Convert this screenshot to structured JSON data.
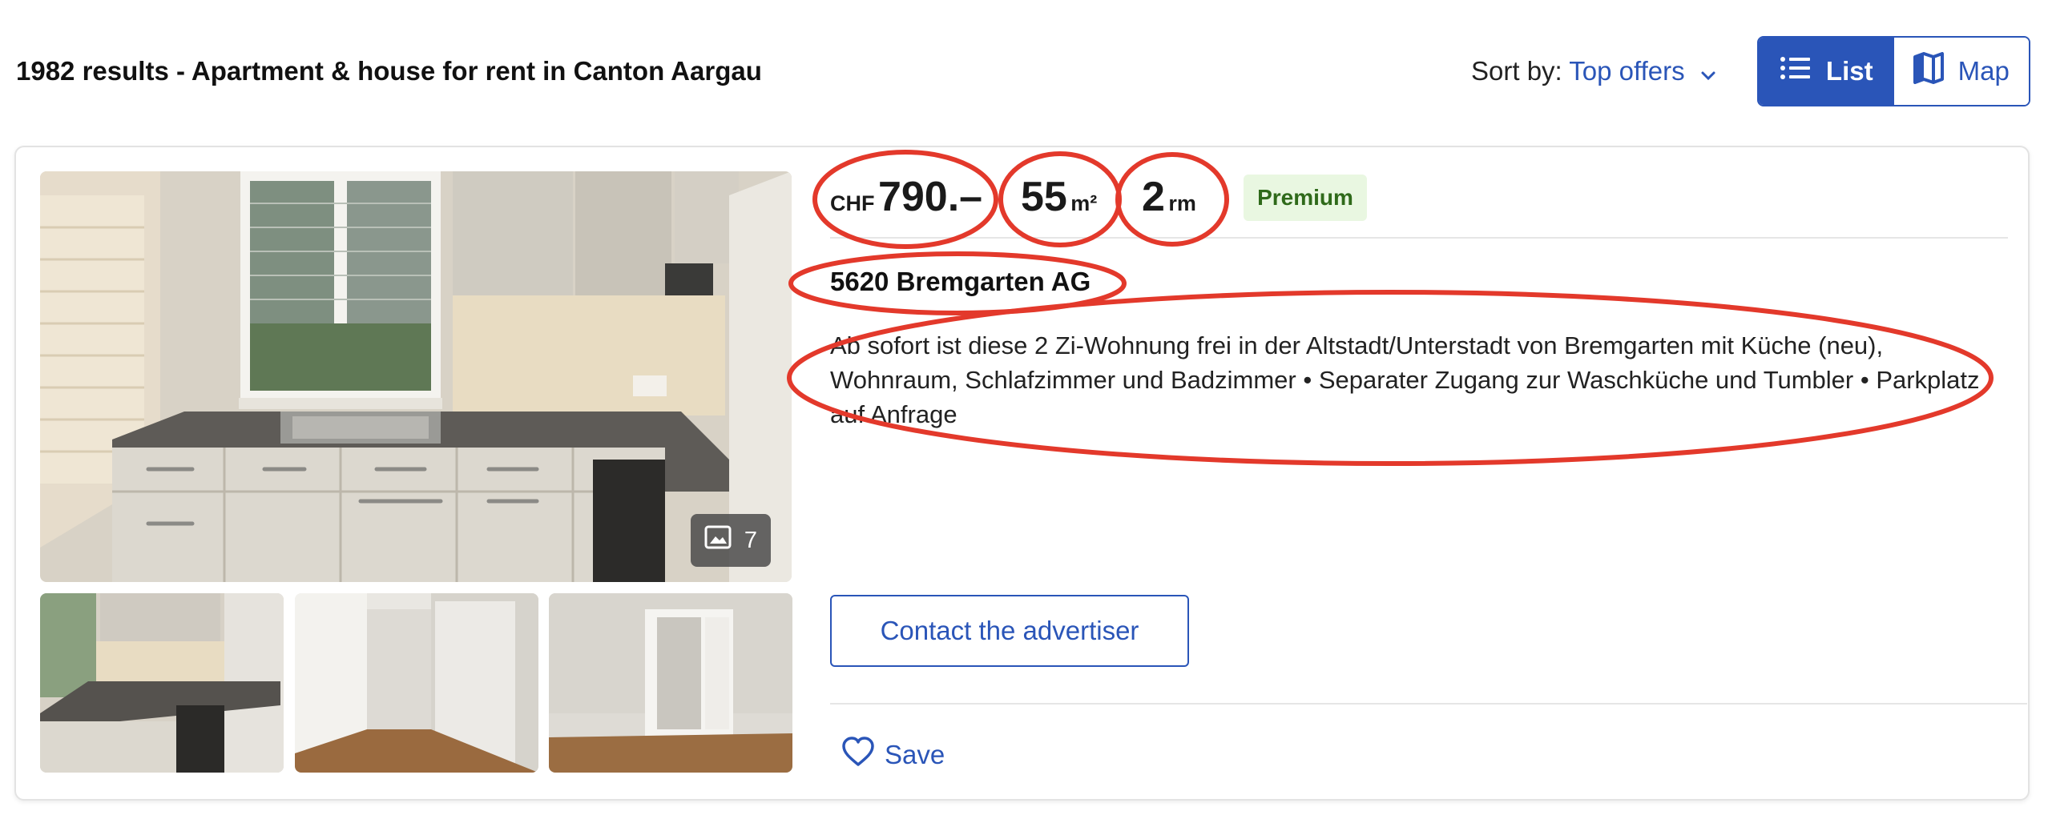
{
  "header": {
    "results_title": "1982 results - Apartment & house for rent in Canton Aargau",
    "sort_label": "Sort by:",
    "sort_value": "Top offers",
    "view_list_label": "List",
    "view_map_label": "Map"
  },
  "listing": {
    "price_currency": "CHF",
    "price_amount": "790.–",
    "area_value": "55",
    "area_unit": "m²",
    "rooms_value": "2",
    "rooms_unit": "rm",
    "badge": "Premium",
    "address": "5620 Bremgarten AG",
    "description": "  Ab sofort ist diese 2 Zi-Wohnung frei in der Altstadt/Unterstadt von Bremgarten mit Küche (neu), Wohnraum, Schlafzimmer und Badzimmer • Separater Zugang zur Waschküche und Tumbler • Parkplatz auf Anfrage",
    "photo_count": "7",
    "contact_label": "Contact the advertiser",
    "save_label": "Save"
  },
  "colors": {
    "accent": "#2a55b8",
    "premium_bg": "#e9f7e1",
    "premium_text": "#2f6a1a",
    "annotation_red": "#e3392b"
  },
  "icons": {
    "sort": "chevron-down-icon",
    "list": "list-icon",
    "map": "map-icon",
    "photos": "image-icon",
    "save": "heart-icon"
  }
}
